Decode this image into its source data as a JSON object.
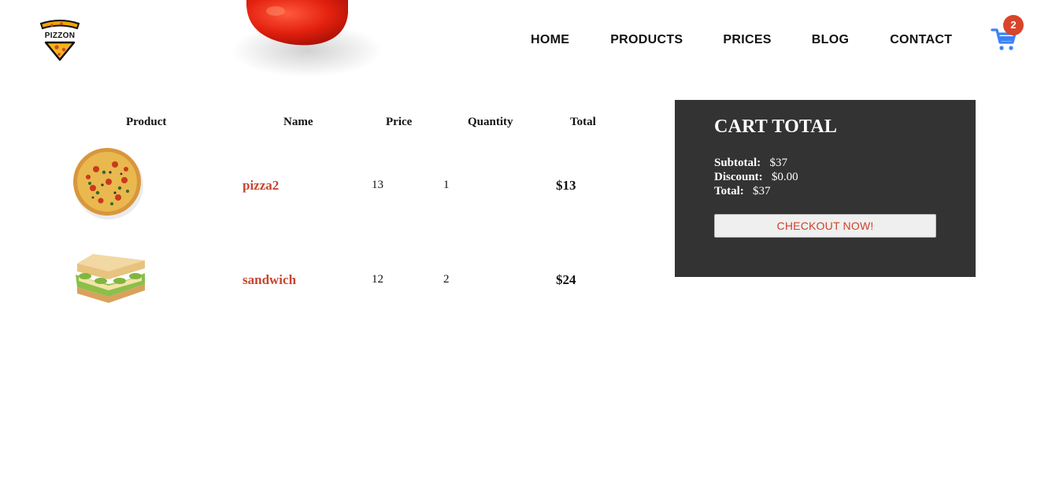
{
  "header": {
    "logo_text": "PIZZON",
    "nav": [
      "HOME",
      "PRODUCTS",
      "PRICES",
      "BLOG",
      "CONTACT"
    ],
    "cart_count": "2",
    "cart_icon": "shopping-cart-icon",
    "cart_color": "#3b82f6",
    "badge_color": "#d9452a"
  },
  "table": {
    "headers": [
      "Product",
      "Name",
      "Price",
      "Quantity",
      "Total"
    ],
    "rows": [
      {
        "image": "pizza-image",
        "name": "pizza2",
        "price": "13",
        "quantity": "1",
        "total": "$13"
      },
      {
        "image": "sandwich-image",
        "name": "sandwich",
        "price": "12",
        "quantity": "2",
        "total": "$24"
      }
    ]
  },
  "cart_total": {
    "title": "CART TOTAL",
    "subtotal_label": "Subtotal:",
    "subtotal_value": "$37",
    "discount_label": "Discount:",
    "discount_value": "$0.00",
    "total_label": "Total:",
    "total_value": "$37",
    "checkout_label": "CHECKOUT NOW!"
  },
  "colors": {
    "accent": "#c8452e",
    "panel_bg": "#333333"
  }
}
